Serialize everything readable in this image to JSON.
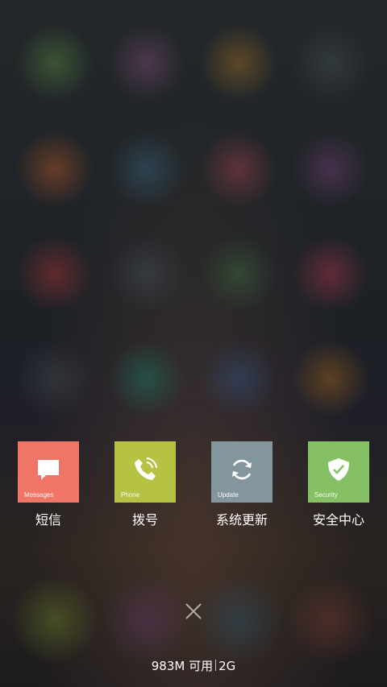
{
  "apps": [
    {
      "caption": "Messages",
      "label": "短信",
      "color": "#ef7566",
      "icon": "message-bubble-icon"
    },
    {
      "caption": "Phone",
      "label": "拨号",
      "color": "#b5c244",
      "icon": "phone-icon"
    },
    {
      "caption": "Update",
      "label": "系统更新",
      "color": "#84969d",
      "icon": "refresh-icon"
    },
    {
      "caption": "Security",
      "label": "安全中心",
      "color": "#86c065",
      "icon": "shield-check-icon"
    }
  ],
  "memory": {
    "available": "983M 可用",
    "total": "2G"
  },
  "close_icon": "close-icon"
}
